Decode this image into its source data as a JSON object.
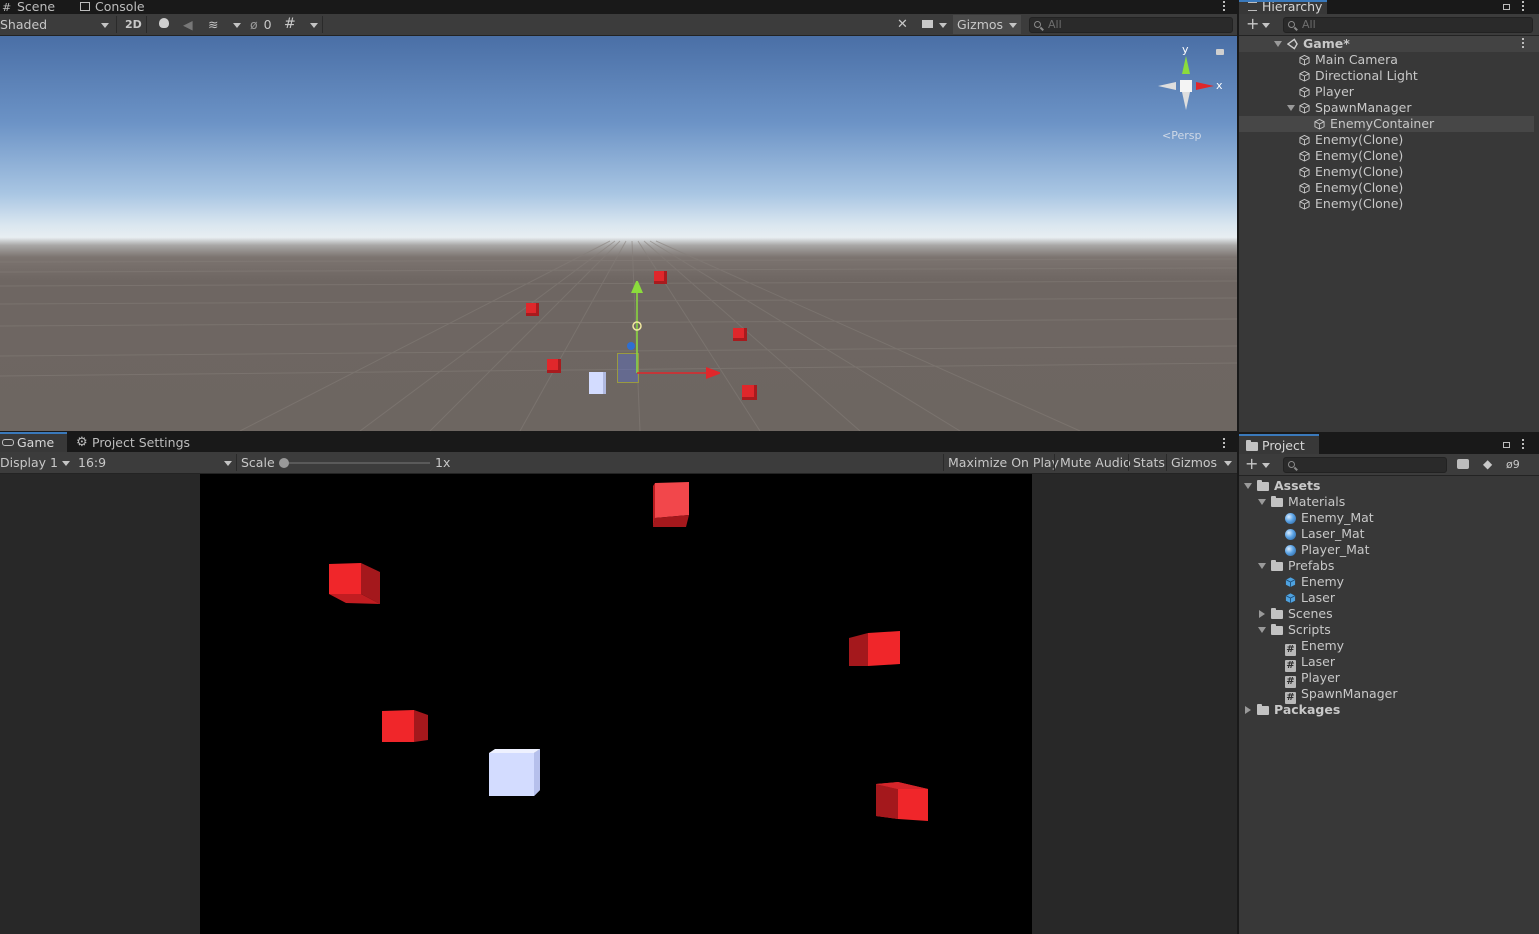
{
  "scene_panel": {
    "tabs": [
      {
        "label": "Scene"
      },
      {
        "label": "Console"
      }
    ],
    "shading_mode": "Shaded",
    "toggle_2d": "2D",
    "hidden_count": "0",
    "gizmos_label": "Gizmos",
    "search_placeholder": "All",
    "persp_label": "Persp",
    "axis_x": "x",
    "axis_y": "y"
  },
  "hierarchy": {
    "title": "Hierarchy",
    "search_placeholder": "All",
    "root": "Game*",
    "items": [
      {
        "label": "Main Camera"
      },
      {
        "label": "Directional Light"
      },
      {
        "label": "Player"
      },
      {
        "label": "SpawnManager"
      },
      {
        "label": "EnemyContainer"
      },
      {
        "label": "Enemy(Clone)"
      },
      {
        "label": "Enemy(Clone)"
      },
      {
        "label": "Enemy(Clone)"
      },
      {
        "label": "Enemy(Clone)"
      },
      {
        "label": "Enemy(Clone)"
      }
    ]
  },
  "game_panel": {
    "tabs": [
      {
        "label": "Game"
      },
      {
        "label": "Project Settings"
      }
    ],
    "display": "Display 1",
    "aspect": "16:9",
    "scale_label": "Scale",
    "scale_value": "1x",
    "buttons": {
      "maximize": "Maximize On Play",
      "mute": "Mute Audio",
      "stats": "Stats",
      "gizmos": "Gizmos"
    }
  },
  "project": {
    "title": "Project",
    "hidden_count": "9",
    "tree": {
      "assets": "Assets",
      "materials": "Materials",
      "materials_items": [
        "Enemy_Mat",
        "Laser_Mat",
        "Player_Mat"
      ],
      "prefabs": "Prefabs",
      "prefabs_items": [
        "Enemy",
        "Laser"
      ],
      "scenes": "Scenes",
      "scripts": "Scripts",
      "scripts_items": [
        "Enemy",
        "Laser",
        "Player",
        "SpawnManager"
      ],
      "packages": "Packages"
    }
  },
  "colors": {
    "enemy_red": "#e8272b",
    "player_white": "#d3dcff",
    "accent_blue": "#3a79bb",
    "selected_row": "#3d3d3d"
  }
}
